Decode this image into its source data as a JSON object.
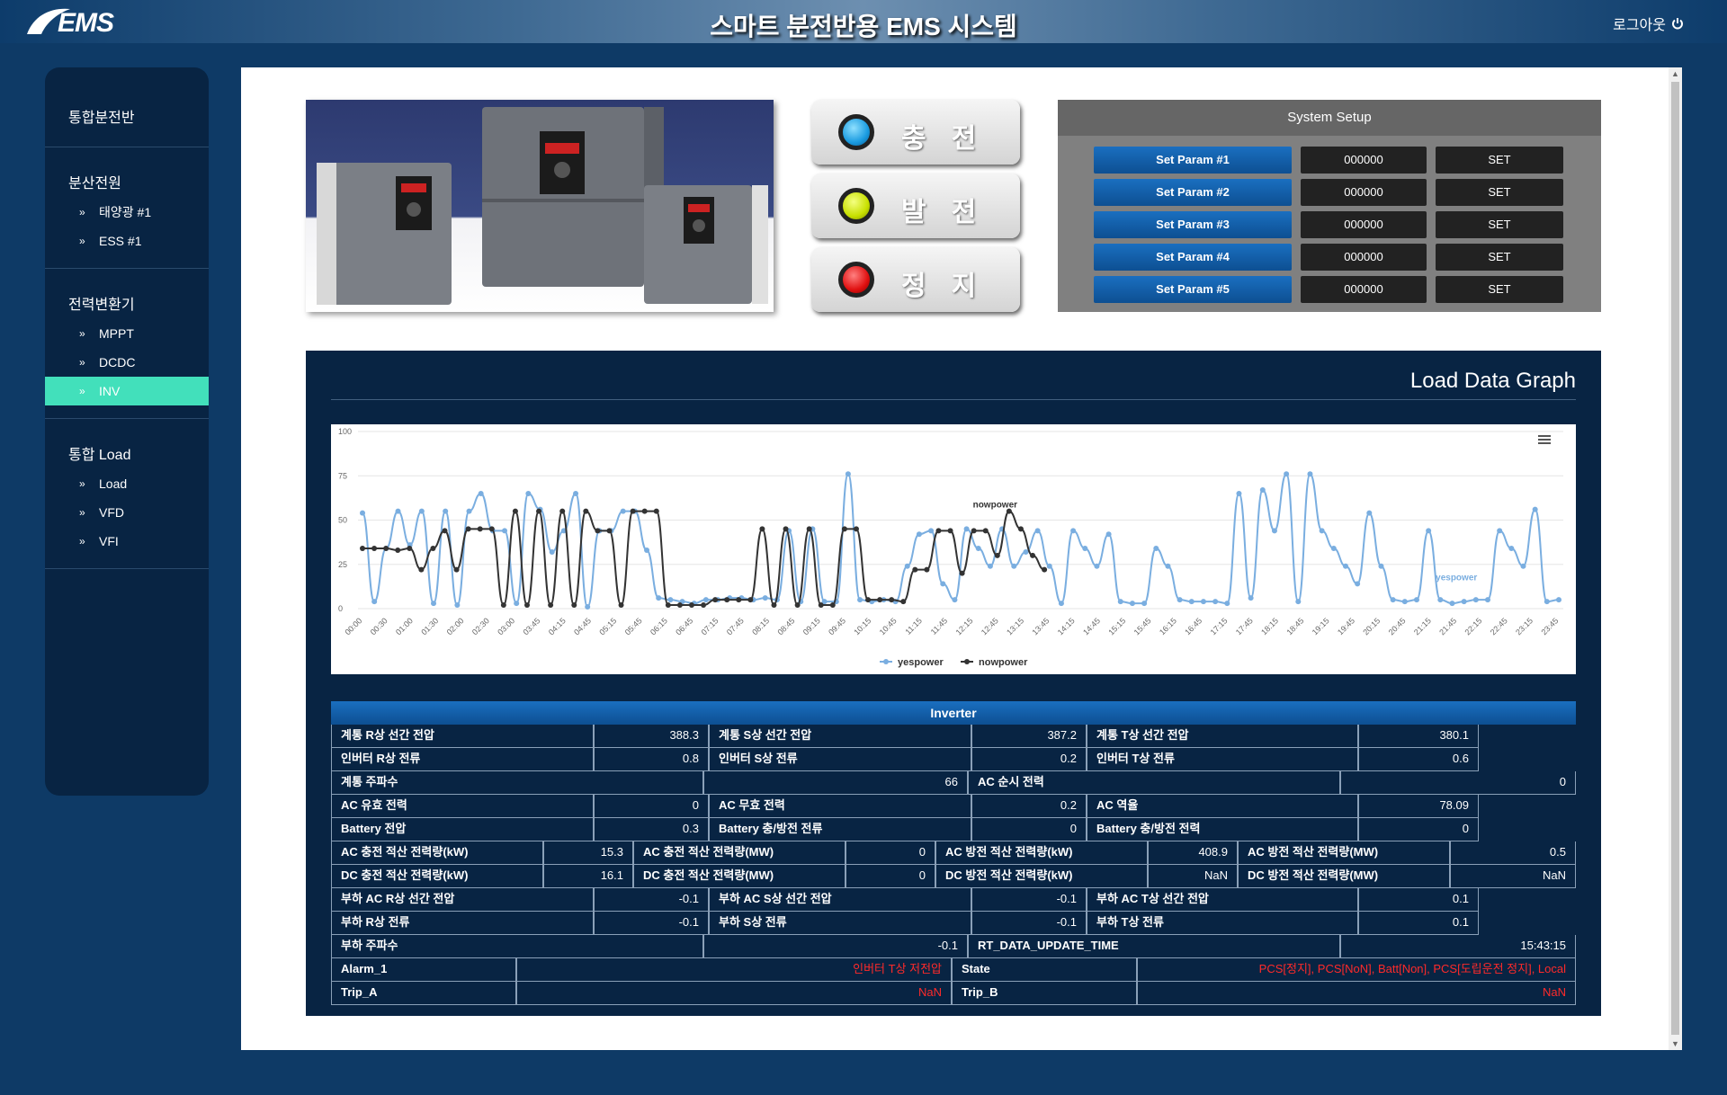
{
  "header": {
    "logo_text": "EMS",
    "title": "스마트 분전반용 EMS 시스템",
    "logout_label": "로그아웃"
  },
  "sidebar": {
    "sections": [
      {
        "label": "통합분전반",
        "items": []
      },
      {
        "label": "분산전원",
        "items": [
          "태양광 #1",
          "ESS #1"
        ]
      },
      {
        "label": "전력변환기",
        "items": [
          "MPPT",
          "DCDC",
          "INV"
        ]
      },
      {
        "label": "통합 Load",
        "items": [
          "Load",
          "VFD",
          "VFI"
        ]
      }
    ],
    "active_item": "INV"
  },
  "controls": {
    "charge": {
      "label": "충전",
      "led_color": "#2aa8e8"
    },
    "generate": {
      "label": "발전",
      "led_color": "#c8e000"
    },
    "stop": {
      "label": "정지",
      "led_color": "#e01010"
    }
  },
  "setup": {
    "title": "System Setup",
    "rows": [
      {
        "param": "Set Param #1",
        "value": "000000",
        "action": "SET"
      },
      {
        "param": "Set Param #2",
        "value": "000000",
        "action": "SET"
      },
      {
        "param": "Set Param #3",
        "value": "000000",
        "action": "SET"
      },
      {
        "param": "Set Param #4",
        "value": "000000",
        "action": "SET"
      },
      {
        "param": "Set Param #5",
        "value": "000000",
        "action": "SET"
      }
    ]
  },
  "graph": {
    "title": "Load Data Graph"
  },
  "chart_data": {
    "type": "line",
    "ylim": [
      0,
      100
    ],
    "yticks": [
      0,
      25,
      50,
      75,
      100
    ],
    "xticks": [
      "00:00",
      "00:30",
      "01:00",
      "01:30",
      "02:00",
      "02:30",
      "03:00",
      "03:45",
      "04:15",
      "04:45",
      "05:15",
      "05:45",
      "06:15",
      "06:45",
      "07:15",
      "07:45",
      "08:15",
      "08:45",
      "09:15",
      "09:45",
      "10:15",
      "10:45",
      "11:15",
      "11:45",
      "12:15",
      "12:45",
      "13:15",
      "13:45",
      "14:15",
      "14:45",
      "15:15",
      "15:45",
      "16:15",
      "16:45",
      "17:15",
      "17:45",
      "18:15",
      "18:45",
      "19:15",
      "19:45",
      "20:15",
      "20:45",
      "21:15",
      "21:45",
      "22:15",
      "22:45",
      "23:15",
      "23:45"
    ],
    "legend": "bottom-center",
    "series": [
      {
        "name": "yespower",
        "color": "#7aaee0",
        "values": [
          54,
          4,
          34,
          55,
          36,
          55,
          3,
          55,
          2,
          55,
          65,
          44,
          44,
          3,
          65,
          56,
          32,
          44,
          65,
          1,
          44,
          44,
          55,
          55,
          33,
          6,
          5,
          4,
          3,
          5,
          5,
          6,
          6,
          5,
          6,
          5,
          44,
          4,
          45,
          4,
          4,
          76,
          5,
          4,
          5,
          4,
          24,
          42,
          44,
          14,
          5,
          45,
          34,
          24,
          45,
          24,
          32,
          44,
          24,
          3,
          44,
          34,
          24,
          42,
          4,
          3,
          3,
          34,
          24,
          5,
          4,
          4,
          4,
          3,
          65,
          6,
          67,
          44,
          76,
          4,
          76,
          44,
          34,
          24,
          14,
          54,
          24,
          5,
          4,
          5,
          44,
          5,
          3,
          4,
          5,
          5,
          44,
          34,
          24,
          56,
          4,
          5
        ]
      },
      {
        "name": "nowpower",
        "color": "#333333",
        "values": [
          34,
          34,
          34,
          33,
          34,
          22,
          34,
          44,
          22,
          45,
          45,
          45,
          2,
          55,
          2,
          55,
          2,
          55,
          2,
          55,
          44,
          44,
          2,
          55,
          55,
          55,
          2,
          2,
          2,
          2,
          5,
          5,
          5,
          5,
          45,
          2,
          45,
          2,
          45,
          2,
          2,
          45,
          45,
          5,
          5,
          5,
          4,
          22,
          22,
          44,
          44,
          20,
          44,
          44,
          30,
          55,
          45,
          30,
          22
        ]
      }
    ],
    "annotations": [
      "nowpower",
      "yespower"
    ]
  },
  "inverter": {
    "title": "Inverter",
    "rows": [
      {
        "cols": [
          [
            "계통 R상 선간 전압",
            "388.3"
          ],
          [
            "계통 S상 선간 전압",
            "387.2"
          ],
          [
            "계통 T상 선간 전압",
            "380.1"
          ]
        ]
      },
      {
        "cols": [
          [
            "인버터 R상 전류",
            "0.8"
          ],
          [
            "인버터 S상 전류",
            "0.2"
          ],
          [
            "인버터 T상 전류",
            "0.6"
          ]
        ]
      },
      {
        "cols": [
          [
            "계통 주파수",
            "66"
          ],
          [
            "AC 순시 전력",
            "0"
          ]
        ]
      },
      {
        "cols": [
          [
            "AC 유효 전력",
            "0"
          ],
          [
            "AC 무효 전력",
            "0.2"
          ],
          [
            "AC 역율",
            "78.09"
          ]
        ]
      },
      {
        "cols": [
          [
            "Battery 전압",
            "0.3"
          ],
          [
            "Battery 충/방전 전류",
            "0"
          ],
          [
            "Battery 충/방전 전력",
            "0"
          ]
        ]
      },
      {
        "cols": [
          [
            "AC 충전 적산 전력량(kW)",
            "15.3"
          ],
          [
            "AC 충전 적산 전력량(MW)",
            "0"
          ],
          [
            "AC 방전 적산 전력량(kW)",
            "408.9"
          ],
          [
            "AC 방전 적산 전력량(MW)",
            "0.5"
          ]
        ]
      },
      {
        "cols": [
          [
            "DC 충전 적산 전력량(kW)",
            "16.1"
          ],
          [
            "DC 충전 적산 전력량(MW)",
            "0"
          ],
          [
            "DC 방전 적산 전력량(kW)",
            "NaN"
          ],
          [
            "DC 방전 적산 전력량(MW)",
            "NaN"
          ]
        ]
      },
      {
        "cols": [
          [
            "부하 AC R상 선간 전압",
            "-0.1"
          ],
          [
            "부하 AC S상 선간 전압",
            "-0.1"
          ],
          [
            "부하 AC T상 선간 전압",
            "0.1"
          ]
        ]
      },
      {
        "cols": [
          [
            "부하 R상 전류",
            "-0.1"
          ],
          [
            "부하 S상 전류",
            "-0.1"
          ],
          [
            "부하 T상 전류",
            "0.1"
          ]
        ]
      },
      {
        "cols": [
          [
            "부하 주파수",
            "-0.1"
          ],
          [
            "RT_DATA_UPDATE_TIME",
            "15:43:15"
          ]
        ]
      },
      {
        "cols": [
          [
            "Alarm_1",
            "인버터 T상 저전압"
          ],
          [
            "State",
            "PCS[정지], PCS[NoN], Batt[Non], PCS[도립운전 정지], Local"
          ]
        ],
        "red": true
      },
      {
        "cols": [
          [
            "Trip_A",
            "NaN"
          ],
          [
            "Trip_B",
            "NaN"
          ]
        ],
        "red": true
      }
    ]
  }
}
